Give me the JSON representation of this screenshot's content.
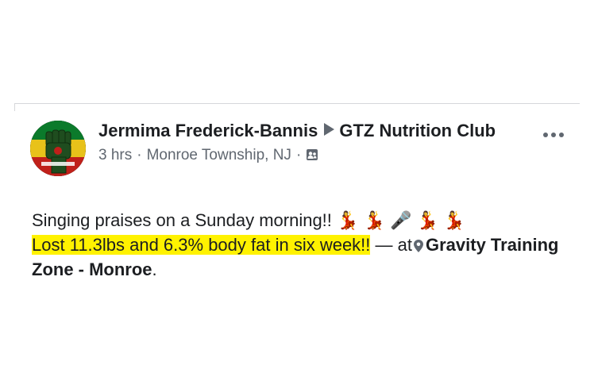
{
  "post": {
    "author": "Jermima Frederick-Bannis",
    "group": "GTZ Nutrition Club",
    "meta": {
      "time": "3 hrs",
      "location": "Monroe Township, NJ",
      "separator": "·",
      "privacy_icon": "friends-icon"
    },
    "more_icon": "more-options-icon",
    "body": {
      "line1": "Singing praises on a Sunday morning!!",
      "line1_emojis": "💃 💃 🎤 💃 💃",
      "highlight": "Lost 11.3lbs and 6.3% body fat in six week!!",
      "at_text": "— at",
      "place_icon": "location-pin-icon",
      "place": "Gravity Training Zone - Monroe",
      "end_punct": "."
    }
  },
  "colors": {
    "text": "#1c1e21",
    "secondary": "#606770",
    "highlight": "#fff200",
    "divider": "#d6d7da"
  }
}
